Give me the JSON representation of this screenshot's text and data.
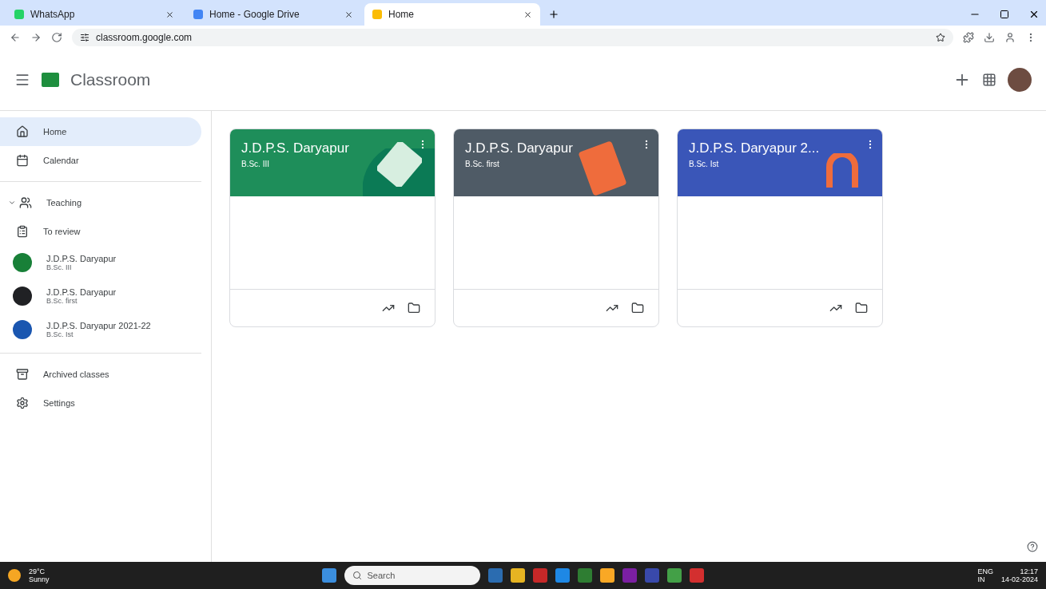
{
  "browser": {
    "tabs": [
      {
        "title": "WhatsApp",
        "selected": false,
        "color": "#25d366"
      },
      {
        "title": "Home - Google Drive",
        "selected": false,
        "color": "#4285f4"
      },
      {
        "title": "Home",
        "selected": true,
        "color": "#fbbc04"
      }
    ],
    "url": "classroom.google.com"
  },
  "app": {
    "title": "Classroom"
  },
  "sidebar": {
    "items": [
      {
        "kind": "nav",
        "label": "Home",
        "selected": true
      },
      {
        "kind": "nav",
        "label": "Calendar",
        "selected": false
      },
      {
        "kind": "section",
        "label": "Teaching",
        "expanded": true,
        "selected": false
      },
      {
        "kind": "nav",
        "label": "To review",
        "selected": false
      },
      {
        "kind": "class",
        "label": "J.D.P.S. Daryapur",
        "sublabel": "B.Sc. III",
        "color": "#188038",
        "selected": false
      },
      {
        "kind": "class",
        "label": "J.D.P.S. Daryapur",
        "sublabel": "B.Sc. first",
        "color": "#202124",
        "selected": false
      },
      {
        "kind": "class",
        "label": "J.D.P.S. Daryapur 2021-22",
        "sublabel": "B.Sc. Ist",
        "color": "#1a56b0",
        "selected": false
      },
      {
        "kind": "nav",
        "label": "Archived classes",
        "selected": false
      },
      {
        "kind": "nav",
        "label": "Settings",
        "selected": false
      }
    ]
  },
  "classes": [
    {
      "title": "J.D.P.S. Daryapur",
      "section": "B.Sc. III",
      "color": "#1e8e5a"
    },
    {
      "title": "J.D.P.S. Daryapur",
      "section": "B.Sc. first",
      "color": "#4f5b66"
    },
    {
      "title": "J.D.P.S. Daryapur 2...",
      "section": "B.Sc. Ist",
      "color": "#3a56b8"
    }
  ],
  "taskbar": {
    "weather": "29°C",
    "weather_note": "Sunny",
    "search_placeholder": "Search",
    "language": "ENG",
    "region": "IN",
    "time": "12:17",
    "date": "14-02-2024"
  }
}
